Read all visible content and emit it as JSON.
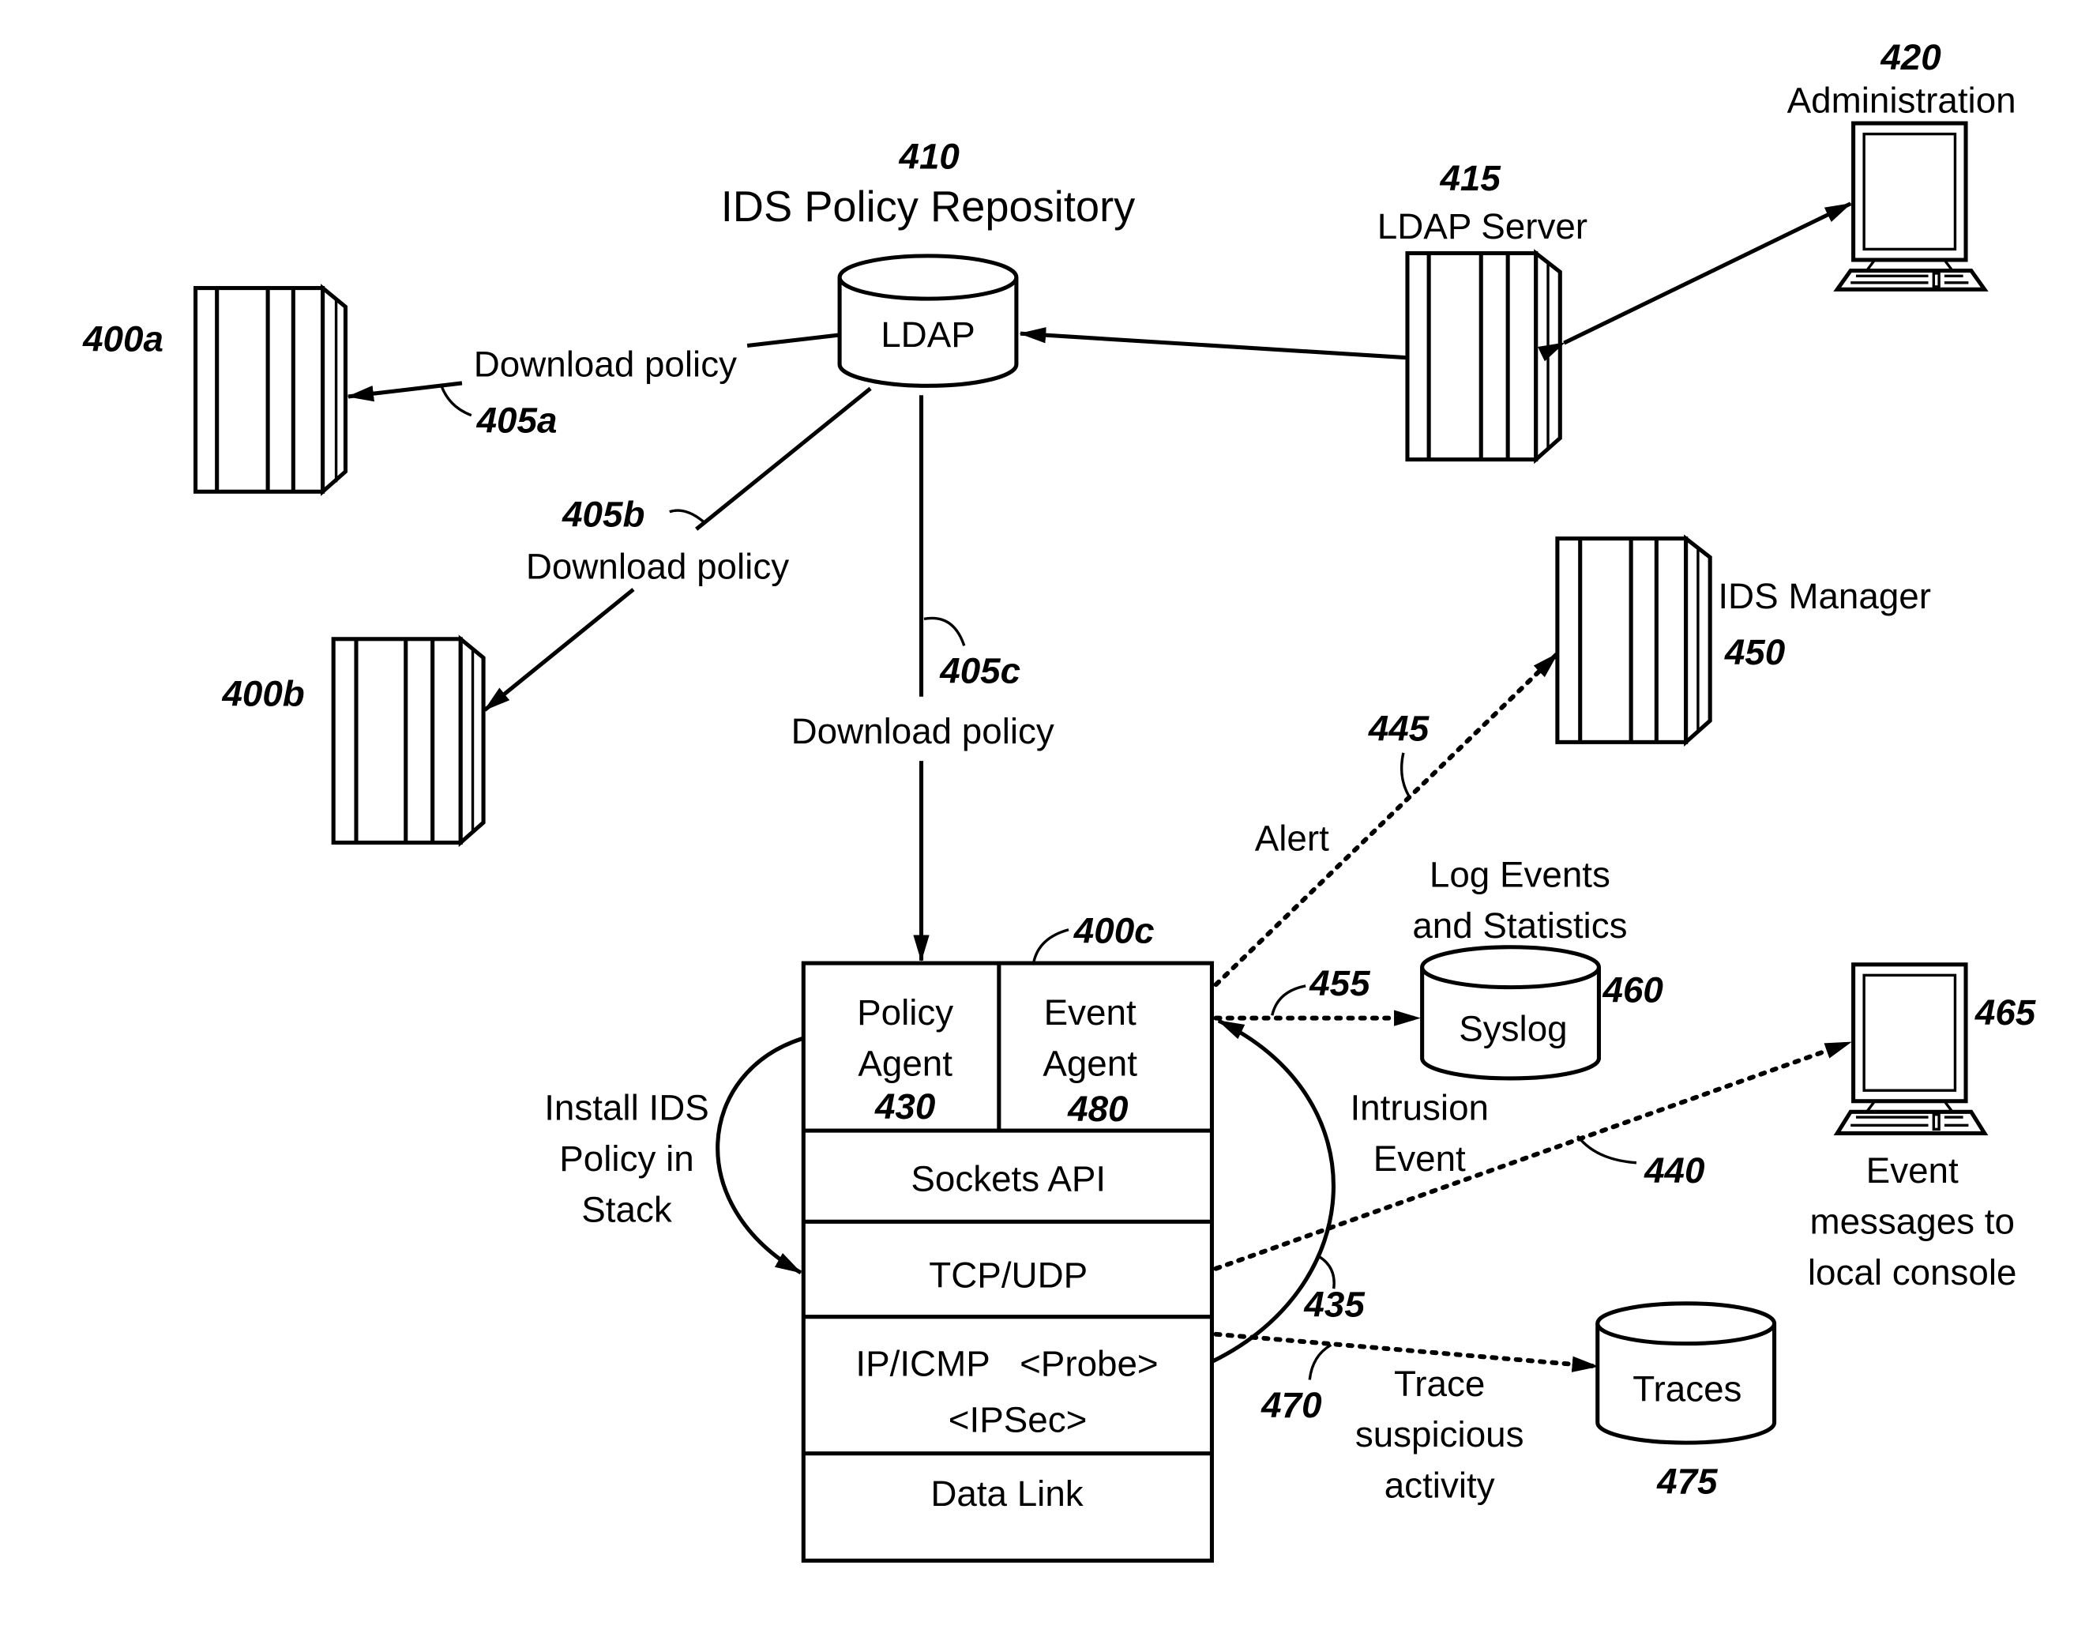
{
  "title": {
    "ref": "410",
    "label": "IDS Policy Repository"
  },
  "ldap_db": {
    "label": "LDAP"
  },
  "ldap_server": {
    "ref": "415",
    "label": "LDAP Server"
  },
  "administration": {
    "ref": "420",
    "label": "Administration"
  },
  "hosts": {
    "a": {
      "ref": "400a"
    },
    "b": {
      "ref": "400b"
    },
    "c": {
      "ref": "400c"
    }
  },
  "flows": {
    "f405a": {
      "ref": "405a",
      "label": "Download policy"
    },
    "f405b": {
      "ref": "405b",
      "label": "Download policy"
    },
    "f405c": {
      "ref": "405c",
      "label": "Download policy"
    },
    "f445": {
      "ref": "445",
      "label": "Alert"
    },
    "f455": {
      "ref": "455"
    },
    "f440": {
      "ref": "440"
    },
    "f435": {
      "ref": "435",
      "label_line1": "Intrusion",
      "label_line2": "Event"
    },
    "f470": {
      "ref": "470",
      "label_line1": "Trace",
      "label_line2": "suspicious",
      "label_line3": "activity"
    },
    "install": {
      "line1": "Install IDS",
      "line2": "Policy in",
      "line3": "Stack"
    }
  },
  "ids_manager": {
    "ref": "450",
    "label": "IDS Manager"
  },
  "syslog": {
    "ref": "460",
    "label": "Syslog",
    "caption_line1": "Log Events",
    "caption_line2": "and Statistics"
  },
  "console": {
    "ref": "465",
    "caption_line1": "Event",
    "caption_line2": "messages to",
    "caption_line3": "local console"
  },
  "traces": {
    "ref": "475",
    "label": "Traces"
  },
  "stack": {
    "policy_agent": {
      "line1": "Policy",
      "line2": "Agent",
      "ref": "430"
    },
    "event_agent": {
      "line1": "Event",
      "line2": "Agent",
      "ref": "480"
    },
    "sockets": "Sockets API",
    "tcpudp": "TCP/UDP",
    "ip_line1": "IP/ICMP   <Probe>",
    "ip_line2": "<IPSec>",
    "datalink": "Data Link"
  }
}
